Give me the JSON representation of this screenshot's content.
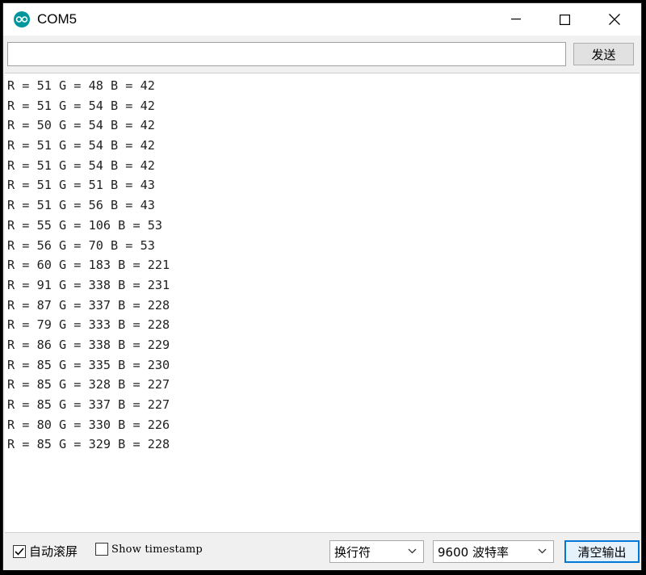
{
  "window": {
    "title": "COM5",
    "accent_color": "#00979c"
  },
  "send_bar": {
    "input_value": "",
    "send_label": "发送"
  },
  "serial_output": [
    "R = 51 G = 48 B = 42",
    "R = 51 G = 54 B = 42",
    "R = 50 G = 54 B = 42",
    "R = 51 G = 54 B = 42",
    "R = 51 G = 54 B = 42",
    "R = 51 G = 51 B = 43",
    "R = 51 G = 56 B = 43",
    "R = 55 G = 106 B = 53",
    "R = 56 G = 70 B = 53",
    "R = 60 G = 183 B = 221",
    "R = 91 G = 338 B = 231",
    "R = 87 G = 337 B = 228",
    "R = 79 G = 333 B = 228",
    "R = 86 G = 338 B = 229",
    "R = 85 G = 335 B = 230",
    "R = 85 G = 328 B = 227",
    "R = 85 G = 337 B = 227",
    "R = 80 G = 330 B = 226",
    "R = 85 G = 329 B = 228"
  ],
  "bottom_bar": {
    "autoscroll_label": "自动滚屏",
    "autoscroll_checked": true,
    "timestamp_label": "Show timestamp",
    "timestamp_checked": false,
    "line_ending_value": "换行符",
    "baud_value": "9600 波特率",
    "clear_label": "清空输出"
  },
  "icons": {
    "app": "arduino-icon",
    "minimize": "minimize-icon",
    "maximize": "maximize-icon",
    "close": "close-icon",
    "dropdown": "chevron-down-icon",
    "check": "checkmark-icon"
  }
}
